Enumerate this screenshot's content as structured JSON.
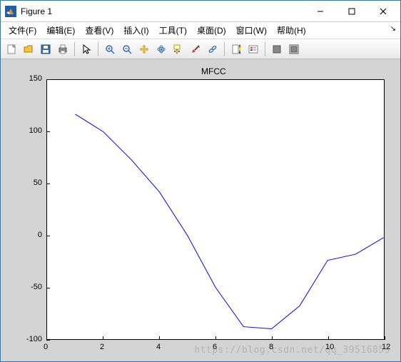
{
  "window": {
    "title": "Figure 1"
  },
  "menu": {
    "file": "文件(F)",
    "edit": "编辑(E)",
    "view": "查看(V)",
    "insert": "插入(I)",
    "tools": "工具(T)",
    "desktop": "桌面(D)",
    "window": "窗口(W)",
    "help": "帮助(H)"
  },
  "toolbar_icons": {
    "new": "new-figure",
    "open": "open-file",
    "save": "save",
    "print": "print",
    "pointer": "pointer",
    "zoom_in": "zoom-in",
    "zoom_out": "zoom-out",
    "pan": "pan",
    "rotate": "rotate-3d",
    "data_cursor": "data-cursor",
    "brush": "brush",
    "link": "link-plot",
    "colorbar": "insert-colorbar",
    "legend": "insert-legend",
    "hide": "hide-tools",
    "dock": "dock-figure"
  },
  "chart_data": {
    "type": "line",
    "title": "MFCC",
    "xlabel": "",
    "ylabel": "",
    "xlim": [
      0,
      12
    ],
    "ylim": [
      -100,
      150
    ],
    "xticks": [
      0,
      2,
      4,
      6,
      8,
      10,
      12
    ],
    "yticks": [
      -100,
      -50,
      0,
      50,
      100,
      150
    ],
    "x": [
      1,
      2,
      3,
      4,
      5,
      6,
      7,
      8,
      9,
      10,
      11,
      12
    ],
    "values": [
      117,
      100,
      73,
      42,
      0,
      -50,
      -88,
      -90,
      -68,
      -24,
      -18,
      -2
    ],
    "series_color": "#0000ff"
  },
  "watermark": "https://blog.csdn.net/qq_39516859"
}
